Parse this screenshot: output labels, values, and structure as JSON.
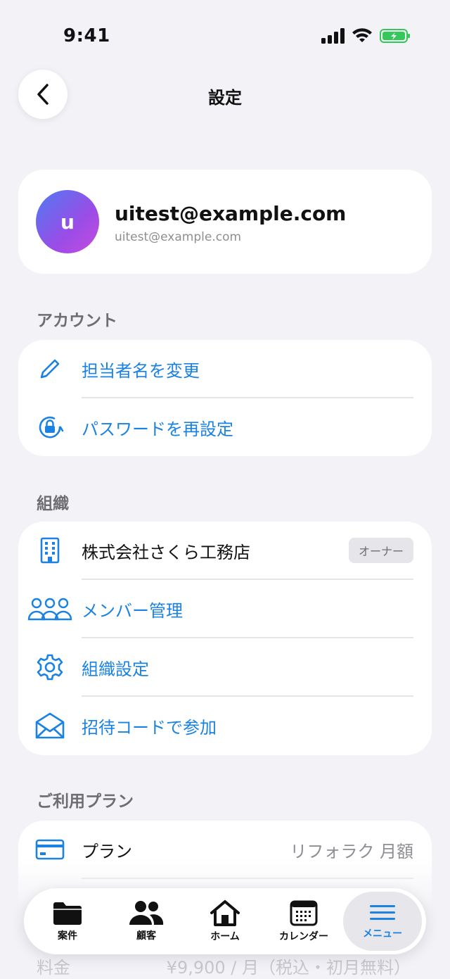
{
  "status": {
    "time": "9:41"
  },
  "nav": {
    "title": "設定"
  },
  "profile": {
    "avatar_initial": "u",
    "name": "uitest@example.com",
    "email": "uitest@example.com"
  },
  "sections": {
    "account": {
      "header": "アカウント",
      "items": [
        {
          "label": "担当者名を変更",
          "icon": "pencil-icon"
        },
        {
          "label": "パスワードを再設定",
          "icon": "lock-reset-icon"
        }
      ]
    },
    "organization": {
      "header": "組織",
      "items": [
        {
          "label": "株式会社さくら工務店",
          "icon": "building-icon",
          "badge": "オーナー"
        },
        {
          "label": "メンバー管理",
          "icon": "members-icon"
        },
        {
          "label": "組織設定",
          "icon": "gear-icon"
        },
        {
          "label": "招待コードで参加",
          "icon": "envelope-icon"
        }
      ]
    },
    "plan": {
      "header": "ご利用プラン",
      "items": [
        {
          "label": "プラン",
          "value": "リフォラク 月額",
          "icon": "credit-card-icon"
        }
      ],
      "fee": {
        "label": "料金",
        "value": "¥9,900 / 月（税込・初月無料）"
      }
    }
  },
  "tabs": [
    {
      "label": "案件",
      "icon": "folder-icon"
    },
    {
      "label": "顧客",
      "icon": "people-icon"
    },
    {
      "label": "ホーム",
      "icon": "home-icon"
    },
    {
      "label": "カレンダー",
      "icon": "calendar-icon"
    },
    {
      "label": "メニュー",
      "icon": "menu-icon",
      "active": true
    }
  ],
  "colors": {
    "accent": "#1A82E2",
    "background": "#F2F2F7",
    "battery": "#34C759"
  }
}
